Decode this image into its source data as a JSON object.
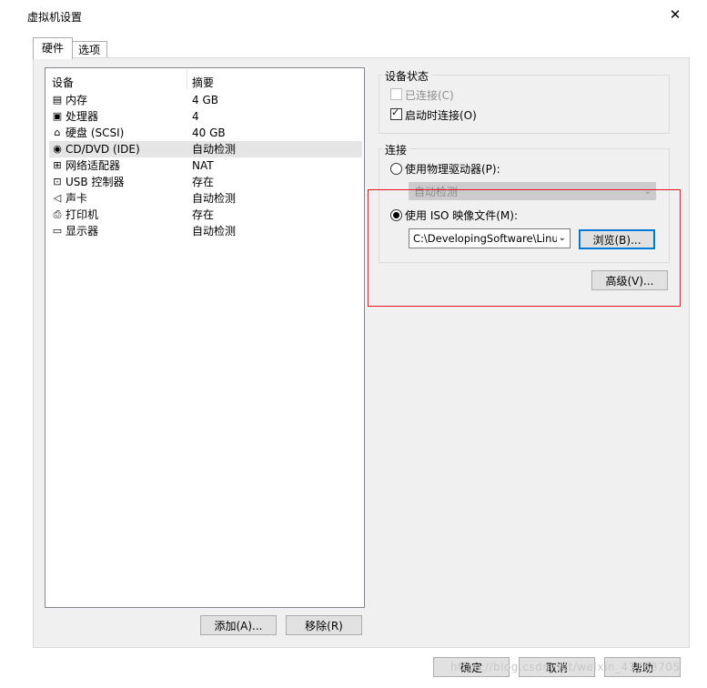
{
  "window": {
    "title": "虚拟机设置"
  },
  "tabs": [
    {
      "label": "硬件"
    },
    {
      "label": "选项"
    }
  ],
  "device_list": {
    "headers": {
      "device": "设备",
      "summary": "摘要"
    },
    "rows": [
      {
        "icon": "memory-icon",
        "name": "内存",
        "summary": "4 GB"
      },
      {
        "icon": "processor-icon",
        "name": "处理器",
        "summary": "4"
      },
      {
        "icon": "hard-disk-icon",
        "name": "硬盘 (SCSI)",
        "summary": "40 GB"
      },
      {
        "icon": "cd-dvd-icon",
        "name": "CD/DVD (IDE)",
        "summary": "自动检测"
      },
      {
        "icon": "network-adapter-icon",
        "name": "网络适配器",
        "summary": "NAT"
      },
      {
        "icon": "usb-icon",
        "name": "USB 控制器",
        "summary": "存在"
      },
      {
        "icon": "sound-card-icon",
        "name": "声卡",
        "summary": "自动检测"
      },
      {
        "icon": "printer-icon",
        "name": "打印机",
        "summary": "存在"
      },
      {
        "icon": "display-icon",
        "name": "显示器",
        "summary": "自动检测"
      }
    ],
    "selected_index": 3,
    "add_button": "添加(A)...",
    "remove_button": "移除(R)"
  },
  "device_status": {
    "title": "设备状态",
    "connected_label": "已连接(C)",
    "connected_checked": false,
    "connect_at_poweron_label": "启动时连接(O)",
    "connect_at_poweron_checked": true
  },
  "connection": {
    "title": "连接",
    "physical_drive_label": "使用物理驱动器(P):",
    "physical_drive_value": "自动检测",
    "iso_label": "使用 ISO 映像文件(M):",
    "iso_path": "C:\\DevelopingSoftware\\Linu",
    "browse_button": "浏览(B)...",
    "selected": "iso"
  },
  "advanced_button": "高级(V)...",
  "footer": {
    "ok_button": "确定",
    "cancel_button": "取消",
    "help_button": "帮助"
  },
  "watermark": "https://blog.csdn.net/weixin_43763705",
  "colors": {
    "highlight": "#e81123",
    "focus": "#0078d7",
    "selection": "#e5e5e5"
  }
}
